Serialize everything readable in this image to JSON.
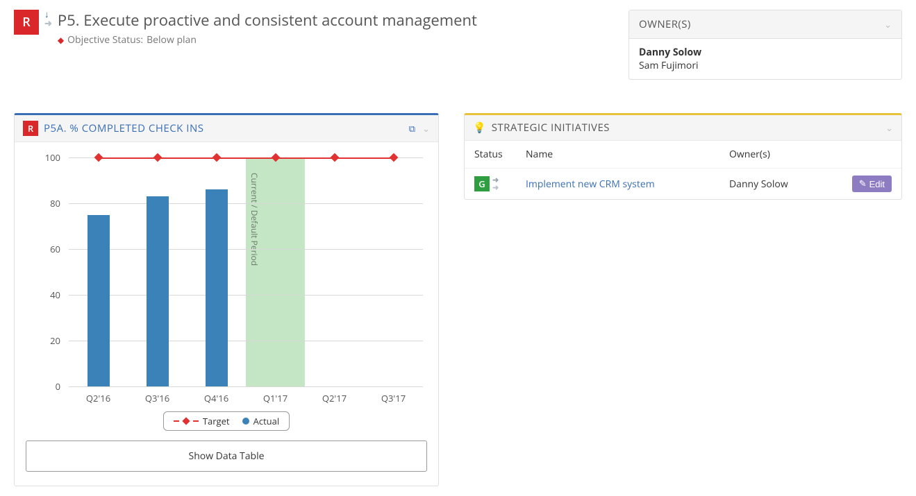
{
  "header": {
    "status_badge": "R",
    "title": "P5. Execute proactive and consistent account management",
    "status_line_label": "Objective Status:",
    "status_line_value": "Below plan"
  },
  "owners_panel": {
    "title": "OWNER(S)",
    "primary": "Danny Solow",
    "secondary": "Sam Fujimori"
  },
  "chart_panel": {
    "badge": "R",
    "title": "P5A. % COMPLETED CHECK INS",
    "show_table": "Show Data Table",
    "legend_target": "Target",
    "legend_actual": "Actual",
    "current_band_label": "Current / Default Period"
  },
  "chart_data": {
    "type": "bar",
    "categories": [
      "Q2'16",
      "Q3'16",
      "Q4'16",
      "Q1'17",
      "Q2'17",
      "Q3'17"
    ],
    "series": [
      {
        "name": "Target",
        "type": "line",
        "values": [
          100,
          100,
          100,
          100,
          100,
          100
        ]
      },
      {
        "name": "Actual",
        "type": "bar",
        "values": [
          75,
          83,
          86,
          null,
          null,
          null
        ]
      }
    ],
    "ylim": [
      0,
      100
    ],
    "yticks": [
      0,
      20,
      40,
      60,
      80,
      100
    ],
    "current_period_index": 3,
    "xlabel": "",
    "ylabel": "",
    "title": "P5A. % COMPLETED CHECK INS"
  },
  "initiatives_panel": {
    "title": "STRATEGIC INITIATIVES",
    "columns": {
      "status": "Status",
      "name": "Name",
      "owner": "Owner(s)"
    },
    "rows": [
      {
        "status": "G",
        "name": "Implement new CRM system",
        "owner": "Danny Solow",
        "edit": "Edit"
      }
    ]
  }
}
